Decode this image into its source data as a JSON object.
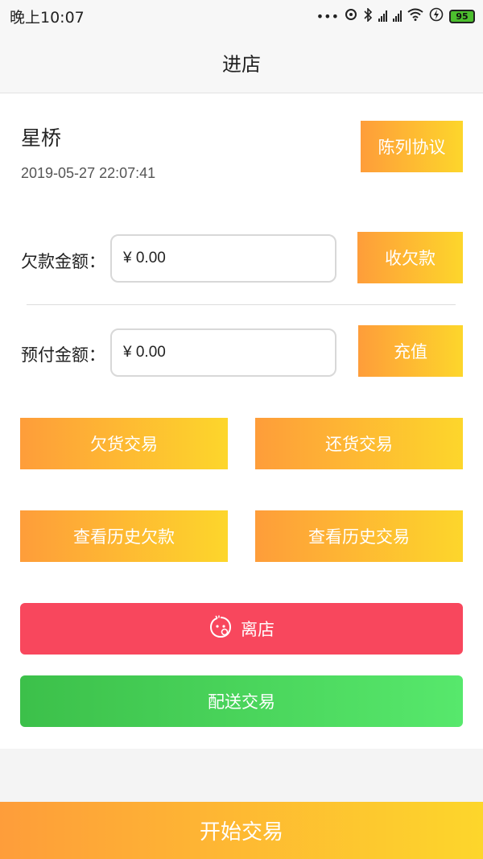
{
  "status_bar": {
    "time": "晚上10:07",
    "dots": "•••",
    "battery": "95"
  },
  "nav": {
    "title": "进店"
  },
  "store": {
    "name": "星桥",
    "time": "2019-05-27 22:07:41",
    "display_agreement_label": "陈列协议"
  },
  "debt": {
    "label": "欠款金额：",
    "value": "¥ 0.00",
    "button": "收欠款"
  },
  "prepaid": {
    "label": "预付金额：",
    "value": "¥ 0.00",
    "button": "充值"
  },
  "actions": {
    "owe_goods": "欠货交易",
    "return_goods": "还货交易",
    "history_debt": "查看历史欠款",
    "history_trade": "查看历史交易",
    "leave_store": "离店",
    "delivery": "配送交易",
    "start_trade": "开始交易"
  },
  "colors": {
    "gradient_start": "#fe9d3a",
    "gradient_end": "#fdd62b",
    "leave": "#f8475d",
    "delivery": "#3cc04a"
  }
}
